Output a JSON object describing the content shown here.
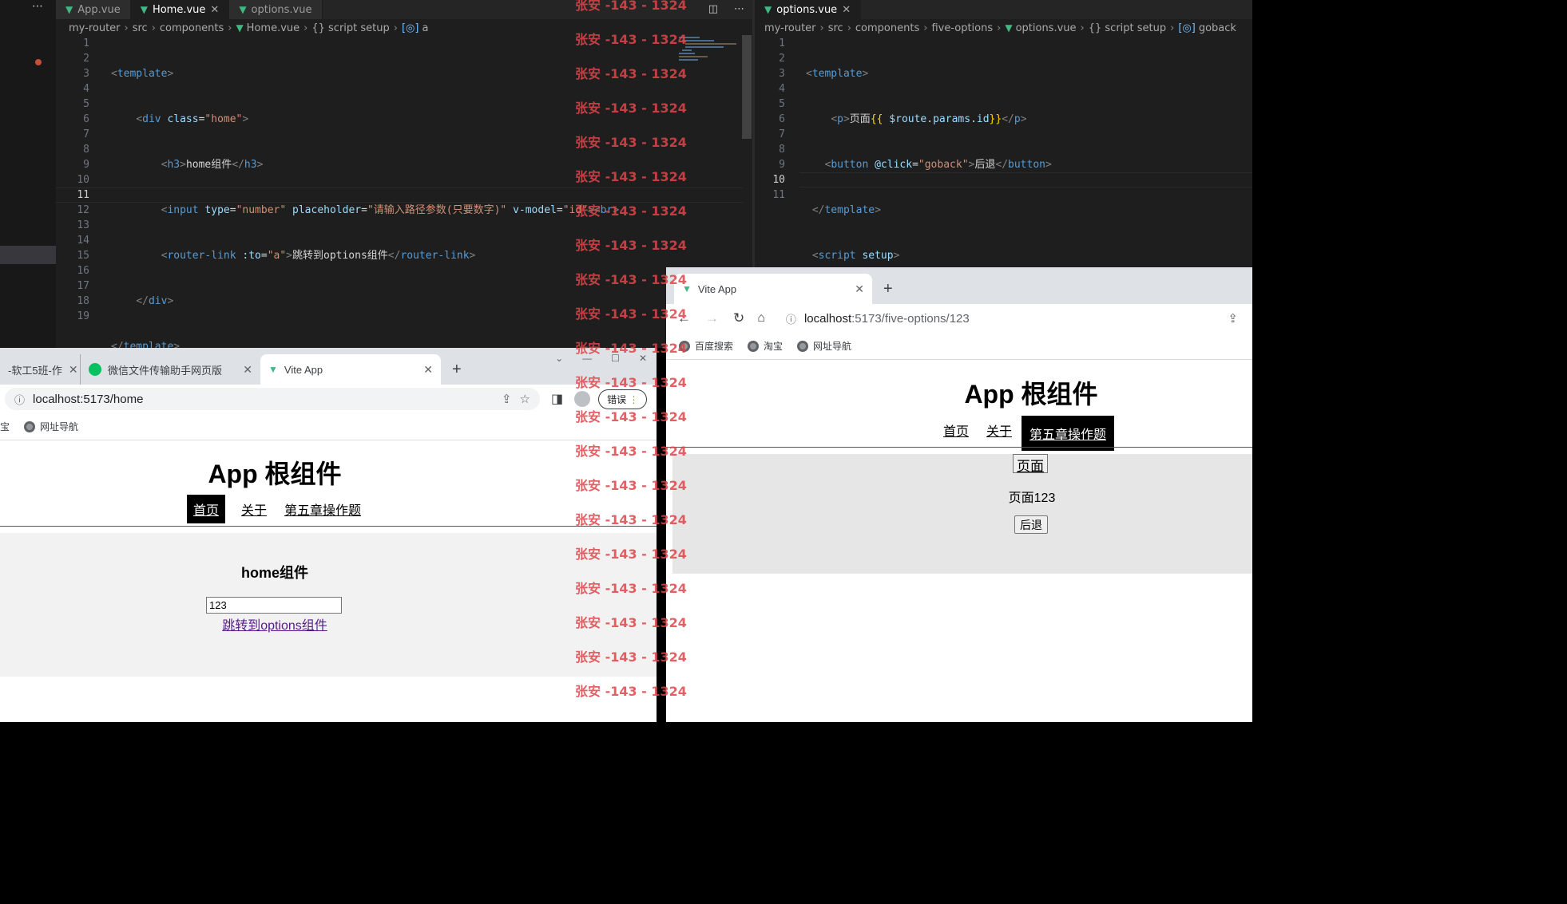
{
  "editor_left": {
    "tabs": [
      {
        "label": "App.vue"
      },
      {
        "label": "Home.vue",
        "active": true
      },
      {
        "label": "options.vue"
      }
    ],
    "breadcrumb": [
      "my-router",
      "src",
      "components",
      "Home.vue",
      "{} script setup",
      "a"
    ],
    "line_numbers": [
      "1",
      "2",
      "3",
      "4",
      "5",
      "6",
      "7",
      "8",
      "9",
      "10",
      "11",
      "12",
      "13",
      "14",
      "15",
      "16",
      "17",
      "18",
      "19"
    ],
    "current_line": "11"
  },
  "editor_right": {
    "tabs": [
      {
        "label": "options.vue",
        "active": true
      }
    ],
    "breadcrumb": [
      "my-router",
      "src",
      "components",
      "five-options",
      "options.vue",
      "{} script setup",
      "goback"
    ],
    "line_numbers": [
      "1",
      "2",
      "3",
      "4",
      "5",
      "6",
      "7",
      "8",
      "9",
      "10",
      "11"
    ],
    "current_line": "10"
  },
  "browser_left": {
    "tabs": [
      {
        "label": "-软工5班-作"
      },
      {
        "label": "微信文件传输助手网页版"
      },
      {
        "label": "Vite App",
        "active": true
      }
    ],
    "url": "localhost:5173/home",
    "profile_button": "错误",
    "bookmarks": [
      "淘宝",
      "网址导航"
    ],
    "app_title": "App 根组件",
    "nav": [
      "首页",
      "关于",
      "第五章操作题"
    ],
    "nav_active": 0,
    "home_heading": "home组件",
    "input_value": "123",
    "link_text": "跳转到options组件"
  },
  "browser_right": {
    "tab": "Vite App",
    "url_host": "localhost",
    "url_rest": ":5173/five-options/123",
    "bookmarks": [
      "百度搜索",
      "淘宝",
      "网址导航"
    ],
    "app_title": "App 根组件",
    "nav": [
      "首页",
      "关于",
      "第五章操作题"
    ],
    "nav_active": 2,
    "page_button": "页面",
    "page_text": "页面123",
    "back_button": "后退"
  },
  "watermark": "张安 -143 - 1324",
  "colors": {
    "vue_green": "#41b883",
    "editor_bg": "#1e1e1e",
    "watermark": "#e0454a",
    "content_gray": "#e6e6e6"
  }
}
